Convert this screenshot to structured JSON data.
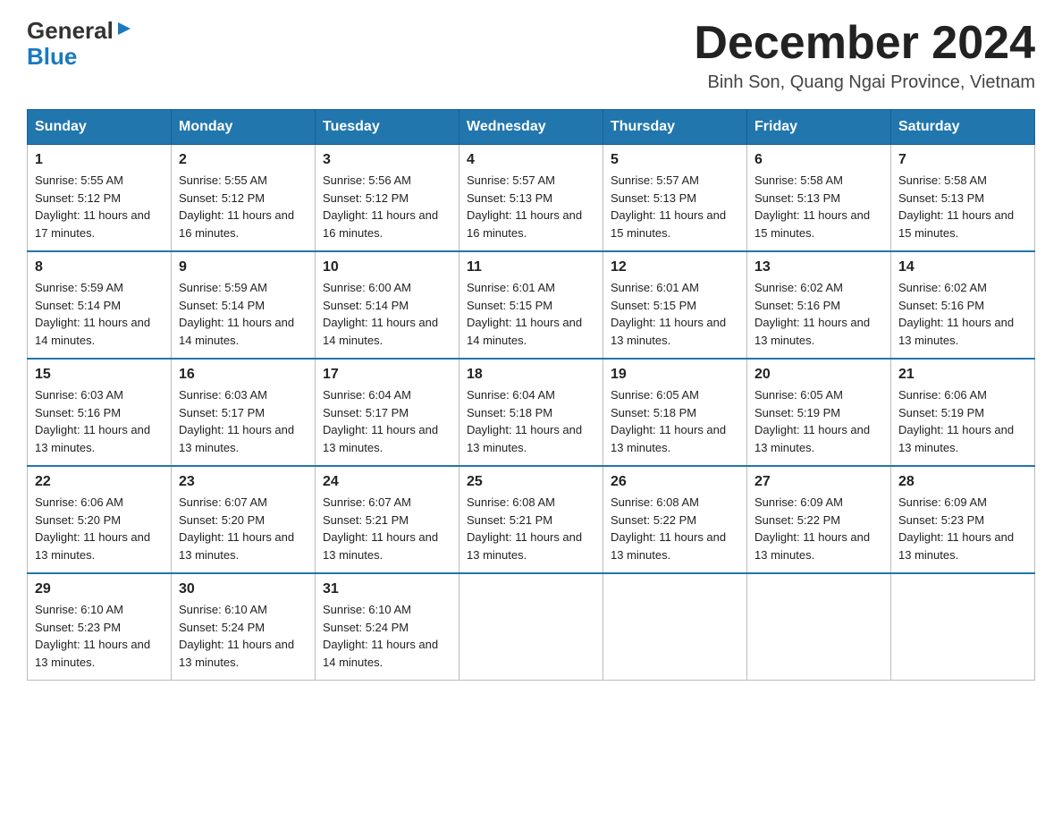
{
  "logo": {
    "general": "General",
    "blue": "Blue",
    "arrow": "▶"
  },
  "title": "December 2024",
  "location": "Binh Son, Quang Ngai Province, Vietnam",
  "days_of_week": [
    "Sunday",
    "Monday",
    "Tuesday",
    "Wednesday",
    "Thursday",
    "Friday",
    "Saturday"
  ],
  "weeks": [
    [
      {
        "day": "1",
        "sunrise": "5:55 AM",
        "sunset": "5:12 PM",
        "daylight": "11 hours and 17 minutes."
      },
      {
        "day": "2",
        "sunrise": "5:55 AM",
        "sunset": "5:12 PM",
        "daylight": "11 hours and 16 minutes."
      },
      {
        "day": "3",
        "sunrise": "5:56 AM",
        "sunset": "5:12 PM",
        "daylight": "11 hours and 16 minutes."
      },
      {
        "day": "4",
        "sunrise": "5:57 AM",
        "sunset": "5:13 PM",
        "daylight": "11 hours and 16 minutes."
      },
      {
        "day": "5",
        "sunrise": "5:57 AM",
        "sunset": "5:13 PM",
        "daylight": "11 hours and 15 minutes."
      },
      {
        "day": "6",
        "sunrise": "5:58 AM",
        "sunset": "5:13 PM",
        "daylight": "11 hours and 15 minutes."
      },
      {
        "day": "7",
        "sunrise": "5:58 AM",
        "sunset": "5:13 PM",
        "daylight": "11 hours and 15 minutes."
      }
    ],
    [
      {
        "day": "8",
        "sunrise": "5:59 AM",
        "sunset": "5:14 PM",
        "daylight": "11 hours and 14 minutes."
      },
      {
        "day": "9",
        "sunrise": "5:59 AM",
        "sunset": "5:14 PM",
        "daylight": "11 hours and 14 minutes."
      },
      {
        "day": "10",
        "sunrise": "6:00 AM",
        "sunset": "5:14 PM",
        "daylight": "11 hours and 14 minutes."
      },
      {
        "day": "11",
        "sunrise": "6:01 AM",
        "sunset": "5:15 PM",
        "daylight": "11 hours and 14 minutes."
      },
      {
        "day": "12",
        "sunrise": "6:01 AM",
        "sunset": "5:15 PM",
        "daylight": "11 hours and 13 minutes."
      },
      {
        "day": "13",
        "sunrise": "6:02 AM",
        "sunset": "5:16 PM",
        "daylight": "11 hours and 13 minutes."
      },
      {
        "day": "14",
        "sunrise": "6:02 AM",
        "sunset": "5:16 PM",
        "daylight": "11 hours and 13 minutes."
      }
    ],
    [
      {
        "day": "15",
        "sunrise": "6:03 AM",
        "sunset": "5:16 PM",
        "daylight": "11 hours and 13 minutes."
      },
      {
        "day": "16",
        "sunrise": "6:03 AM",
        "sunset": "5:17 PM",
        "daylight": "11 hours and 13 minutes."
      },
      {
        "day": "17",
        "sunrise": "6:04 AM",
        "sunset": "5:17 PM",
        "daylight": "11 hours and 13 minutes."
      },
      {
        "day": "18",
        "sunrise": "6:04 AM",
        "sunset": "5:18 PM",
        "daylight": "11 hours and 13 minutes."
      },
      {
        "day": "19",
        "sunrise": "6:05 AM",
        "sunset": "5:18 PM",
        "daylight": "11 hours and 13 minutes."
      },
      {
        "day": "20",
        "sunrise": "6:05 AM",
        "sunset": "5:19 PM",
        "daylight": "11 hours and 13 minutes."
      },
      {
        "day": "21",
        "sunrise": "6:06 AM",
        "sunset": "5:19 PM",
        "daylight": "11 hours and 13 minutes."
      }
    ],
    [
      {
        "day": "22",
        "sunrise": "6:06 AM",
        "sunset": "5:20 PM",
        "daylight": "11 hours and 13 minutes."
      },
      {
        "day": "23",
        "sunrise": "6:07 AM",
        "sunset": "5:20 PM",
        "daylight": "11 hours and 13 minutes."
      },
      {
        "day": "24",
        "sunrise": "6:07 AM",
        "sunset": "5:21 PM",
        "daylight": "11 hours and 13 minutes."
      },
      {
        "day": "25",
        "sunrise": "6:08 AM",
        "sunset": "5:21 PM",
        "daylight": "11 hours and 13 minutes."
      },
      {
        "day": "26",
        "sunrise": "6:08 AM",
        "sunset": "5:22 PM",
        "daylight": "11 hours and 13 minutes."
      },
      {
        "day": "27",
        "sunrise": "6:09 AM",
        "sunset": "5:22 PM",
        "daylight": "11 hours and 13 minutes."
      },
      {
        "day": "28",
        "sunrise": "6:09 AM",
        "sunset": "5:23 PM",
        "daylight": "11 hours and 13 minutes."
      }
    ],
    [
      {
        "day": "29",
        "sunrise": "6:10 AM",
        "sunset": "5:23 PM",
        "daylight": "11 hours and 13 minutes."
      },
      {
        "day": "30",
        "sunrise": "6:10 AM",
        "sunset": "5:24 PM",
        "daylight": "11 hours and 13 minutes."
      },
      {
        "day": "31",
        "sunrise": "6:10 AM",
        "sunset": "5:24 PM",
        "daylight": "11 hours and 14 minutes."
      },
      null,
      null,
      null,
      null
    ]
  ],
  "labels": {
    "sunrise": "Sunrise:",
    "sunset": "Sunset:",
    "daylight": "Daylight:"
  }
}
